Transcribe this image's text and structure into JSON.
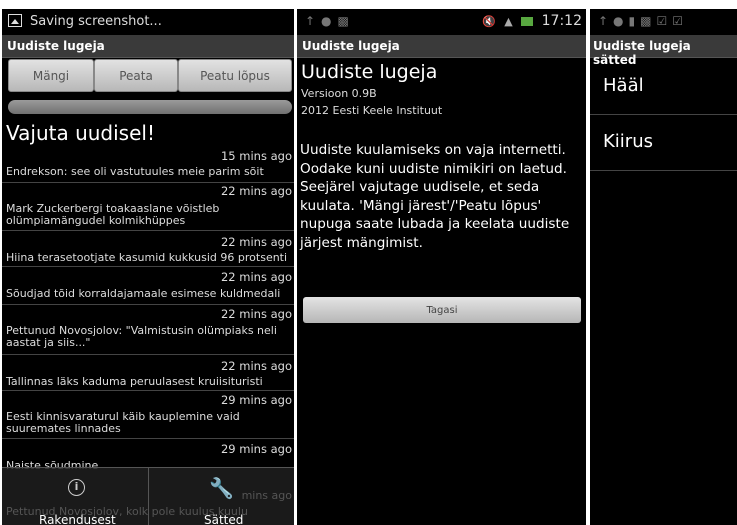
{
  "screen1": {
    "status_text": "Saving screenshot...",
    "title": "Uudiste lugeja",
    "buttons": [
      "Mängi",
      "Peata",
      "Peatu lõpus"
    ],
    "prompt": "Vajuta uudisel!",
    "news": [
      {
        "time": "15 mins ago",
        "headline": "Endrekson: see oli vastutuules meie parim sõit"
      },
      {
        "time": "22 mins ago",
        "headline": "Mark Zuckerbergi toakaaslane võistleb olümpiamängudel kolmikhüppes"
      },
      {
        "time": "22 mins ago",
        "headline": "Hiina terasetootjate kasumid kukkusid 96 protsenti"
      },
      {
        "time": "22 mins ago",
        "headline": "Sõudjad tõid korraldajamaale esimese kuldmedali"
      },
      {
        "time": "22 mins ago",
        "headline": "Pettunud Novosjolov: \"Valmistusin olümpiaks neli aastat ja siis...\""
      },
      {
        "time": "22 mins ago",
        "headline": "Tallinnas läks kaduma peruulasest kruiisituristi"
      },
      {
        "time": "29 mins ago",
        "headline": "Eesti kinnisvaraturul käib kauplemine vaid suuremates linnades"
      },
      {
        "time": "29 mins ago",
        "headline": "Naiste sõudmine"
      }
    ],
    "bottom": {
      "about_label": "Rakendusest",
      "settings_label": "Sätted",
      "faded_time": "mins ago",
      "faded_text": "Pettunud Novosjolov, kolk pole kuulus kuulu"
    }
  },
  "screen2": {
    "status_time": "17:12",
    "title": "Uudiste lugeja",
    "app_name": "Uudiste lugeja",
    "version": "Versioon 0.9B",
    "copyright": "2012 Eesti Keele Instituut",
    "description": "Uudiste kuulamiseks on vaja internetti. Oodake kuni uudiste nimikiri on laetud. Seejärel vajutage uudisele, et seda kuulata. 'Mängi järest'/'Peatu lõpus' nupuga saate lubada ja keelata uudiste järjest mängimist.",
    "back_button": "Tagasi"
  },
  "screen3": {
    "title": "Uudiste lugeja sätted",
    "settings": [
      "Hääl",
      "Kiirus"
    ]
  }
}
